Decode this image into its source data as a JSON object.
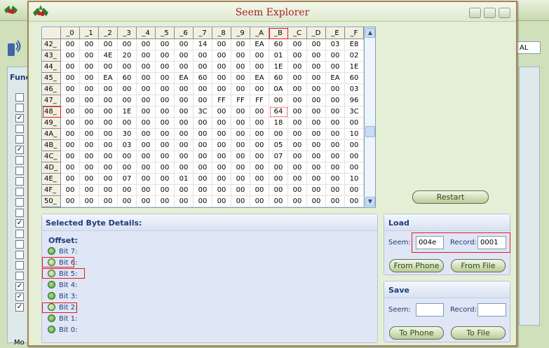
{
  "window": {
    "title": "Seem Explorer"
  },
  "background": {
    "func_label": "Func",
    "status_label": "Mo",
    "right_label": "AL"
  },
  "hex_grid": {
    "column_headers": [
      "_0",
      "_1",
      "_2",
      "_3",
      "_4",
      "_5",
      "_6",
      "_7",
      "_8",
      "_9",
      "_A",
      "_B",
      "_C",
      "_D",
      "_E",
      "_F"
    ],
    "rows": [
      {
        "label": "42_",
        "cells": [
          "00",
          "00",
          "00",
          "00",
          "00",
          "00",
          "00",
          "14",
          "00",
          "00",
          "EA",
          "60",
          "00",
          "00",
          "03",
          "E8"
        ]
      },
      {
        "label": "43_",
        "cells": [
          "00",
          "00",
          "4E",
          "20",
          "00",
          "00",
          "00",
          "00",
          "00",
          "00",
          "00",
          "01",
          "00",
          "00",
          "00",
          "02"
        ]
      },
      {
        "label": "44_",
        "cells": [
          "00",
          "00",
          "00",
          "00",
          "00",
          "00",
          "00",
          "00",
          "00",
          "00",
          "00",
          "1E",
          "00",
          "00",
          "00",
          "1E"
        ]
      },
      {
        "label": "45_",
        "cells": [
          "00",
          "00",
          "EA",
          "60",
          "00",
          "00",
          "EA",
          "60",
          "00",
          "00",
          "EA",
          "60",
          "00",
          "00",
          "EA",
          "60"
        ]
      },
      {
        "label": "46_",
        "cells": [
          "00",
          "00",
          "00",
          "00",
          "00",
          "00",
          "00",
          "00",
          "00",
          "00",
          "00",
          "0A",
          "00",
          "00",
          "00",
          "03"
        ]
      },
      {
        "label": "47_",
        "cells": [
          "00",
          "00",
          "00",
          "00",
          "00",
          "00",
          "00",
          "00",
          "FF",
          "FF",
          "FF",
          "00",
          "00",
          "00",
          "00",
          "96"
        ]
      },
      {
        "label": "48_",
        "cells": [
          "00",
          "00",
          "00",
          "1E",
          "00",
          "00",
          "00",
          "3C",
          "00",
          "00",
          "00",
          "64",
          "00",
          "00",
          "00",
          "3C"
        ]
      },
      {
        "label": "49_",
        "cells": [
          "00",
          "00",
          "00",
          "00",
          "00",
          "00",
          "00",
          "00",
          "00",
          "00",
          "00",
          "18",
          "00",
          "00",
          "00",
          "00"
        ]
      },
      {
        "label": "4A_",
        "cells": [
          "00",
          "00",
          "00",
          "30",
          "00",
          "00",
          "00",
          "00",
          "00",
          "00",
          "00",
          "00",
          "00",
          "00",
          "00",
          "10"
        ]
      },
      {
        "label": "4B_",
        "cells": [
          "00",
          "00",
          "00",
          "03",
          "00",
          "00",
          "00",
          "00",
          "00",
          "00",
          "00",
          "05",
          "00",
          "00",
          "00",
          "00"
        ]
      },
      {
        "label": "4C_",
        "cells": [
          "00",
          "00",
          "00",
          "00",
          "00",
          "00",
          "00",
          "00",
          "00",
          "00",
          "00",
          "07",
          "00",
          "00",
          "00",
          "00"
        ]
      },
      {
        "label": "4D_",
        "cells": [
          "00",
          "00",
          "00",
          "00",
          "00",
          "00",
          "00",
          "00",
          "00",
          "00",
          "00",
          "00",
          "00",
          "00",
          "00",
          "00"
        ]
      },
      {
        "label": "4E_",
        "cells": [
          "00",
          "00",
          "00",
          "07",
          "00",
          "00",
          "01",
          "00",
          "00",
          "00",
          "00",
          "00",
          "00",
          "00",
          "00",
          "10"
        ]
      },
      {
        "label": "4F_",
        "cells": [
          "00",
          "00",
          "00",
          "00",
          "00",
          "00",
          "00",
          "00",
          "00",
          "00",
          "00",
          "00",
          "00",
          "00",
          "00",
          "00"
        ]
      },
      {
        "label": "50_",
        "cells": [
          "00",
          "00",
          "00",
          "00",
          "00",
          "00",
          "00",
          "00",
          "00",
          "00",
          "00",
          "00",
          "00",
          "00",
          "00",
          "00"
        ]
      }
    ]
  },
  "details": {
    "header": "Selected Byte Details:",
    "offset_label": "Offset:",
    "bits": [
      {
        "label": "Bit 7:",
        "set": false
      },
      {
        "label": "Bit 6:",
        "set": true
      },
      {
        "label": "Bit 5:",
        "set": true
      },
      {
        "label": "Bit 4:",
        "set": false
      },
      {
        "label": "Bit 3:",
        "set": false
      },
      {
        "label": "Bit 2:",
        "set": true
      },
      {
        "label": "Bit 1:",
        "set": false
      },
      {
        "label": "Bit 0:",
        "set": false
      }
    ]
  },
  "restart_label": "Restart",
  "load": {
    "header": "Load",
    "seem_label": "Seem:",
    "seem_value": "004e",
    "record_label": "Record:",
    "record_value": "0001",
    "from_phone": "From Phone",
    "from_file": "From File"
  },
  "save": {
    "header": "Save",
    "seem_label": "Seem:",
    "seem_value": "",
    "record_label": "Record:",
    "record_value": "",
    "to_phone": "To Phone",
    "to_file": "To File"
  },
  "colors": {
    "title": "#a5222b",
    "highlight": "#e31b1b",
    "accent_text": "#203c78"
  }
}
